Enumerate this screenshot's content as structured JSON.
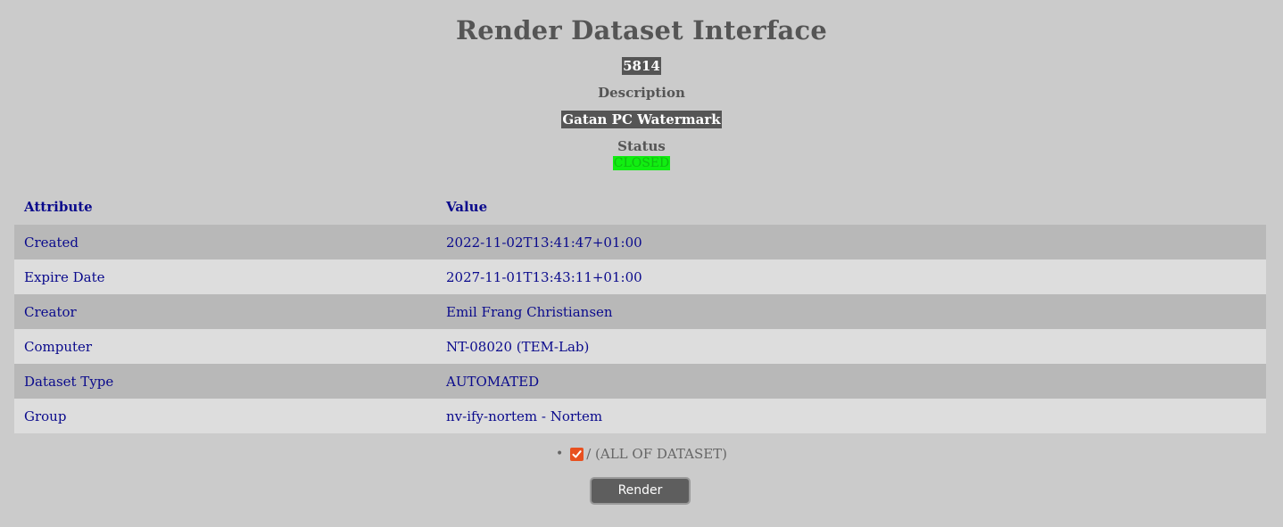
{
  "header": {
    "title": "Render Dataset Interface",
    "dataset_id": "5814",
    "description_label": "Description",
    "description_value": "Gatan PC Watermark",
    "status_label": "Status",
    "status_value": "CLOSED"
  },
  "colors": {
    "background": "#cbcbcb",
    "badge_bg": "#555555",
    "status_green": "#11ee11",
    "table_text": "#0a0a8c",
    "checkbox_accent": "#e8501f"
  },
  "table": {
    "headers": [
      "Attribute",
      "Value"
    ],
    "rows": [
      {
        "attribute": "Created",
        "value": "2022-11-02T13:41:47+01:00"
      },
      {
        "attribute": "Expire Date",
        "value": "2027-11-01T13:43:11+01:00"
      },
      {
        "attribute": "Creator",
        "value": "Emil Frang Christiansen"
      },
      {
        "attribute": "Computer",
        "value": "NT-08020 (TEM-Lab)"
      },
      {
        "attribute": "Dataset Type",
        "value": "AUTOMATED"
      },
      {
        "attribute": "Group",
        "value": "nv-ify-nortem - Nortem"
      }
    ]
  },
  "path_selection": {
    "checked": true,
    "label": "/ (ALL OF DATASET)"
  },
  "actions": {
    "render_label": "Render"
  }
}
